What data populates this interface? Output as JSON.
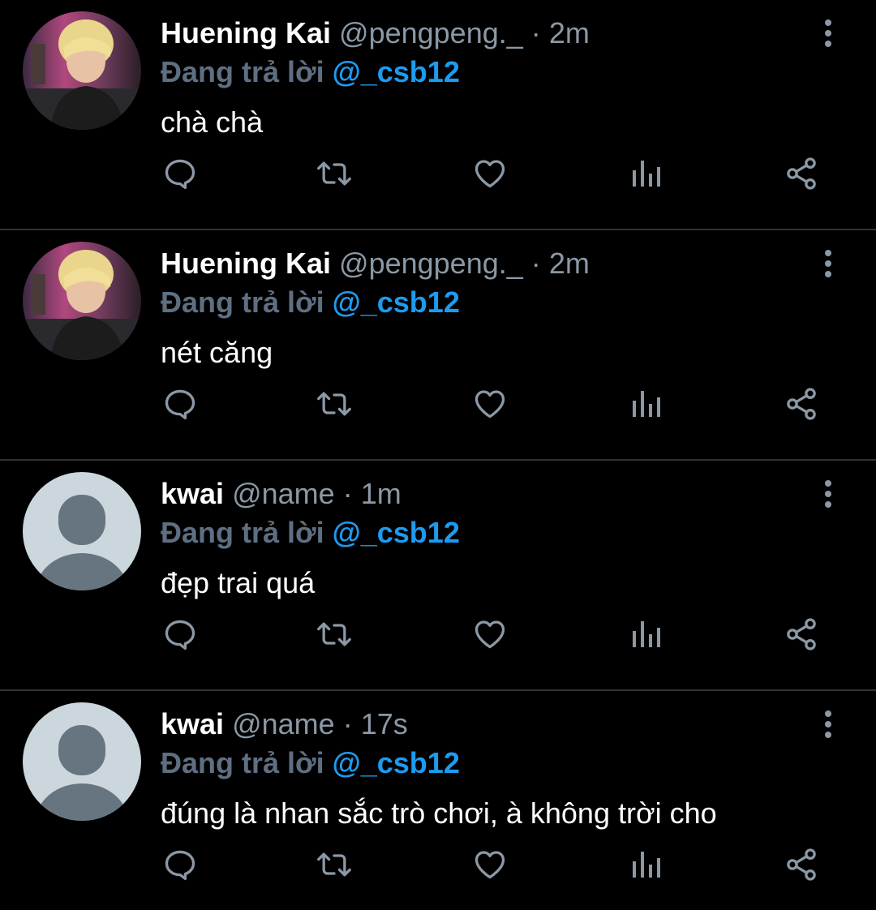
{
  "colors": {
    "background": "#000000",
    "divider": "#2f3336",
    "secondary_text": "#8b98a5",
    "reply_prefix": "#5f6f82",
    "accent": "#1d9bf0",
    "icon": "#8b98a5"
  },
  "tweets": [
    {
      "avatar": "photo-avatar",
      "display_name": "Huening Kai",
      "handle": "@pengpeng._",
      "separator": "·",
      "time": "2m",
      "reply_prefix": "Đang trả lời",
      "reply_target": "@_csb12",
      "text": "chà chà"
    },
    {
      "avatar": "photo-avatar",
      "display_name": "Huening Kai",
      "handle": "@pengpeng._",
      "separator": "·",
      "time": "2m",
      "reply_prefix": "Đang trả lời",
      "reply_target": "@_csb12",
      "text": "nét căng"
    },
    {
      "avatar": "default-avatar",
      "display_name": "kwai",
      "handle": "@name",
      "separator": "·",
      "time": "1m",
      "reply_prefix": "Đang trả lời",
      "reply_target": "@_csb12",
      "text": "đẹp trai quá"
    },
    {
      "avatar": "default-avatar",
      "display_name": "kwai",
      "handle": "@name",
      "separator": "·",
      "time": "17s",
      "reply_prefix": "Đang trả lời",
      "reply_target": "@_csb12",
      "text": "đúng là nhan sắc trò chơi, à không trời cho"
    }
  ],
  "actions": [
    "reply-icon",
    "retweet-icon",
    "like-icon",
    "analytics-icon",
    "share-icon"
  ],
  "more_icon": "more-vertical-icon"
}
